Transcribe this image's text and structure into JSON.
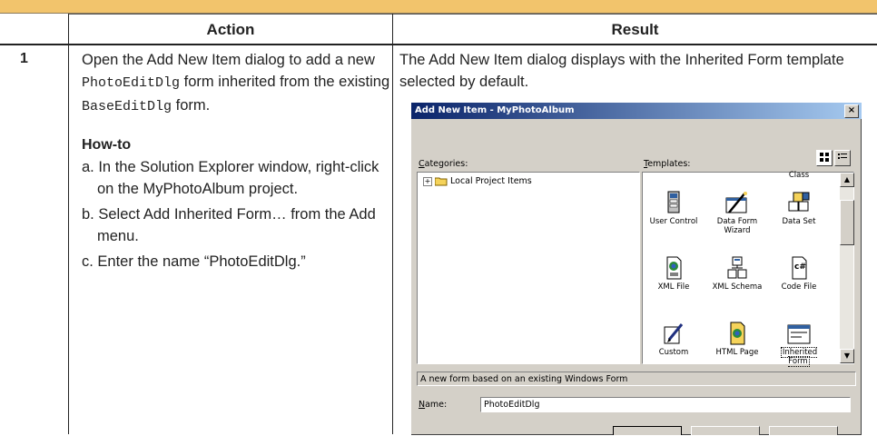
{
  "table": {
    "header_action": "Action",
    "header_result": "Result",
    "step_number": "1",
    "action_intro_1": "Open the Add New Item dialog to add a new ",
    "action_code_1": "PhotoEditDlg",
    "action_intro_2": " form inherited from the existing ",
    "action_code_2": "BaseEditDlg",
    "action_intro_3": " form.",
    "howto_title": "How-to",
    "howto_steps": [
      "a. In the Solution Explorer window, right-click on the MyPhotoAlbum project.",
      "b. Select Add Inherited Form… from the Add menu.",
      "c. Enter the name “PhotoEditDlg.”"
    ],
    "result_text": "The Add New Item dialog displays with the Inherited Form template selected by default."
  },
  "dialog": {
    "title": "Add New Item - MyPhotoAlbum",
    "close": "×",
    "categories_label_first": "C",
    "categories_label_rest": "ategories:",
    "templates_label_first": "T",
    "templates_label_rest": "emplates:",
    "tree_item": "Local Project Items",
    "tree_expander": "+",
    "templates": [
      {
        "label": "Class",
        "icon": "class-icon"
      },
      {
        "label": "User Control",
        "icon": "user-control-icon"
      },
      {
        "label": "Data Form Wizard",
        "icon": "data-form-wizard-icon"
      },
      {
        "label": "Data Set",
        "icon": "data-set-icon"
      },
      {
        "label": "XML File",
        "icon": "xml-file-icon"
      },
      {
        "label": "XML Schema",
        "icon": "xml-schema-icon"
      },
      {
        "label": "Code File",
        "icon": "code-file-icon"
      },
      {
        "label": "Custom",
        "icon": "custom-icon"
      },
      {
        "label": "HTML Page",
        "icon": "html-page-icon"
      },
      {
        "label": "Inherited Form",
        "icon": "inherited-form-icon",
        "selected": true
      }
    ],
    "description": "A new form based on an existing Windows Form",
    "name_label_first": "N",
    "name_label_rest": "ame:",
    "name_value": "PhotoEditDlg",
    "code_glyph": "c#"
  },
  "colors": {
    "topbar": "#f2c46c",
    "titlebar_start": "#0a246a",
    "titlebar_end": "#a6caf0",
    "dialog_bg": "#d4d0c8"
  }
}
